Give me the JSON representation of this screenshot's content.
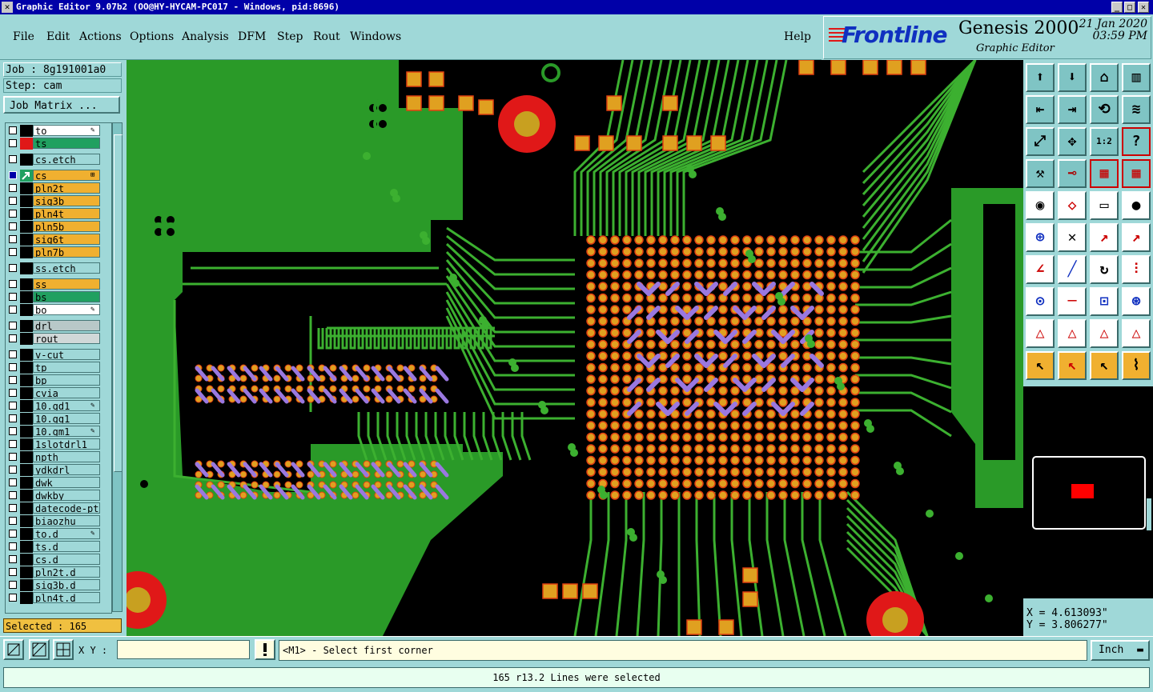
{
  "window": {
    "title": "Graphic Editor 9.07b2  (OO@HY-HYCAM-PC017 - Windows, pid:8696)",
    "sys_icon": "✕",
    "controls": [
      "_",
      "□",
      "✕"
    ]
  },
  "menu": {
    "items": [
      "File",
      "Edit",
      "Actions",
      "Options",
      "Analysis",
      "DFM",
      "Step",
      "Rout",
      "Windows"
    ],
    "help": "Help"
  },
  "brand": {
    "logo": "Frontline",
    "product": "Genesis 2000",
    "subtitle": "Graphic Editor",
    "date": "21 Jan 2020",
    "time": "03:59 PM"
  },
  "job": {
    "job_label": "Job : 8g191001a0",
    "step_label": "Step: cam",
    "matrix_button": "Job Matrix ..."
  },
  "layers": [
    {
      "name": "to",
      "color": "#ffffff",
      "mark": "#000000",
      "edit": true
    },
    {
      "name": "ts",
      "color": "#20a060",
      "mark": "#e01818"
    },
    {
      "name": "cs.etch",
      "color": "#9fd8d8",
      "mark": "#000000"
    },
    {
      "name": "cs",
      "color": "#f0b030",
      "mark": "#20a060",
      "active": true
    },
    {
      "name": "pln2t",
      "color": "#f0b030",
      "mark": "#000000"
    },
    {
      "name": "sig3b",
      "color": "#f0b030",
      "mark": "#000000"
    },
    {
      "name": "pln4t",
      "color": "#f0b030",
      "mark": "#000000"
    },
    {
      "name": "pln5b",
      "color": "#f0b030",
      "mark": "#000000"
    },
    {
      "name": "sig6t",
      "color": "#f0b030",
      "mark": "#000000"
    },
    {
      "name": "pln7b",
      "color": "#f0b030",
      "mark": "#000000"
    },
    {
      "name": "ss.etch",
      "color": "#9fd8d8",
      "mark": "#000000"
    },
    {
      "name": "ss",
      "color": "#f0b030",
      "mark": "#000000"
    },
    {
      "name": "bs",
      "color": "#20a060",
      "mark": "#000000"
    },
    {
      "name": "bo",
      "color": "#ffffff",
      "mark": "#000000",
      "edit": true
    },
    {
      "name": "drl",
      "color": "#b8c8c8",
      "mark": "#000000"
    },
    {
      "name": "rout",
      "color": "#d0d8d8",
      "mark": "#000000"
    },
    {
      "name": "v-cut",
      "color": "#9fd8d8",
      "mark": "#000000"
    },
    {
      "name": "tp",
      "color": "#9fd8d8",
      "mark": "#000000"
    },
    {
      "name": "bp",
      "color": "#9fd8d8",
      "mark": "#000000"
    },
    {
      "name": "cvia",
      "color": "#9fd8d8",
      "mark": "#000000"
    },
    {
      "name": "10.gd1",
      "color": "#9fd8d8",
      "mark": "#000000",
      "edit": true
    },
    {
      "name": "10.gg1",
      "color": "#9fd8d8",
      "mark": "#000000"
    },
    {
      "name": "10.gm1",
      "color": "#9fd8d8",
      "mark": "#000000",
      "edit": true
    },
    {
      "name": "1slotdrl1",
      "color": "#9fd8d8",
      "mark": "#000000"
    },
    {
      "name": "npth",
      "color": "#9fd8d8",
      "mark": "#000000"
    },
    {
      "name": "ydkdrl",
      "color": "#9fd8d8",
      "mark": "#000000"
    },
    {
      "name": "dwk",
      "color": "#9fd8d8",
      "mark": "#000000"
    },
    {
      "name": "dwkby",
      "color": "#9fd8d8",
      "mark": "#000000"
    },
    {
      "name": "datecode-pt",
      "color": "#9fd8d8",
      "mark": "#000000"
    },
    {
      "name": "biaozhu",
      "color": "#9fd8d8",
      "mark": "#000000"
    },
    {
      "name": "to.d",
      "color": "#9fd8d8",
      "mark": "#000000",
      "edit": true
    },
    {
      "name": "ts.d",
      "color": "#9fd8d8",
      "mark": "#000000"
    },
    {
      "name": "cs.d",
      "color": "#9fd8d8",
      "mark": "#000000"
    },
    {
      "name": "pln2t.d",
      "color": "#9fd8d8",
      "mark": "#000000"
    },
    {
      "name": "sig3b.d",
      "color": "#9fd8d8",
      "mark": "#000000"
    },
    {
      "name": "pln4t.d",
      "color": "#9fd8d8",
      "mark": "#000000"
    }
  ],
  "selected_label": "Selected : 165",
  "coords": {
    "x": "X = 4.613093\"",
    "y": "Y = 3.806277\""
  },
  "bottom": {
    "xy_label": "X Y :",
    "xy_value": "",
    "prompt": "<M1> - Select first corner",
    "unit": "Inch",
    "status": "165 r13.2 Lines were selected"
  },
  "colors": {
    "copper": "#2a9a28",
    "trace": "#3cb030",
    "pad": "#e0a020",
    "pad_outline": "#e04010",
    "selected_line": "#9a78e0",
    "hole_ring": "#e01818"
  },
  "tools": [
    "zoom-home-icon",
    "zoom-out-icon",
    "home-view-icon",
    "split-view-icon",
    "pan-left-icon",
    "pan-right-icon",
    "redraw-icon",
    "snake-icon",
    "fit-icon",
    "center-icon",
    "one-to-one-icon",
    "help-question-icon",
    "tools-icon",
    "measure-dot-icon",
    "layers-icon",
    "layers-alt-icon",
    "circle-frame-icon",
    "shape-icon",
    "ruler-icon",
    "target-icon",
    "nodes-icon",
    "cross-icon",
    "line-arrow-icon",
    "line-up-icon",
    "angle-icon",
    "diagonal-icon",
    "arc-icon",
    "feature-icon",
    "pad-add-icon",
    "line-add-icon",
    "dim-icon",
    "circle-group-icon",
    "tri1-icon",
    "tri2-icon",
    "tri3-icon",
    "tri4-icon",
    "pointer-icon",
    "select-box-icon",
    "select-arrow-icon",
    "route-icon"
  ]
}
